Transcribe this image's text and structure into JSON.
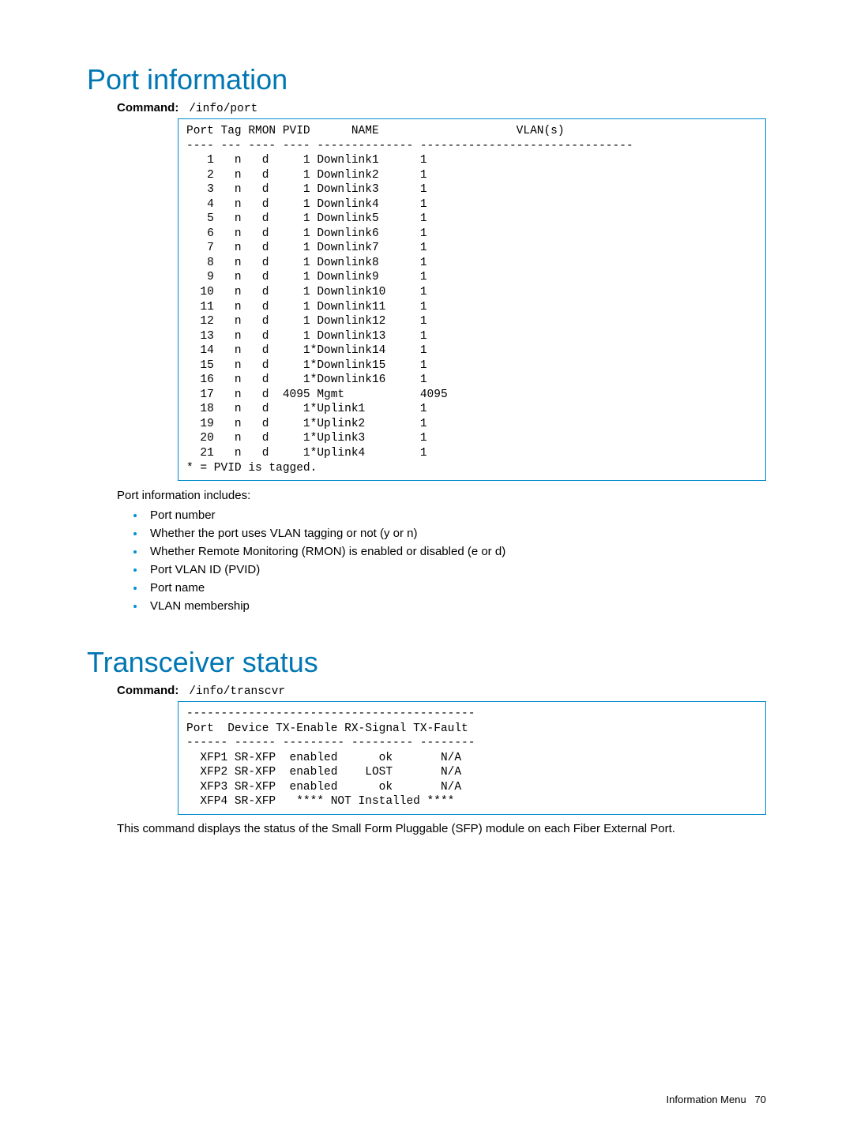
{
  "section1": {
    "title": "Port information",
    "cmd_label": "Command:",
    "cmd_value": "/info/port",
    "code": "Port Tag RMON PVID      NAME                    VLAN(s)\n---- --- ---- ---- -------------- -------------------------------\n   1   n   d     1 Downlink1      1\n   2   n   d     1 Downlink2      1\n   3   n   d     1 Downlink3      1\n   4   n   d     1 Downlink4      1\n   5   n   d     1 Downlink5      1\n   6   n   d     1 Downlink6      1\n   7   n   d     1 Downlink7      1\n   8   n   d     1 Downlink8      1\n   9   n   d     1 Downlink9      1\n  10   n   d     1 Downlink10     1\n  11   n   d     1 Downlink11     1\n  12   n   d     1 Downlink12     1\n  13   n   d     1 Downlink13     1\n  14   n   d     1*Downlink14     1\n  15   n   d     1*Downlink15     1\n  16   n   d     1*Downlink16     1\n  17   n   d  4095 Mgmt           4095\n  18   n   d     1*Uplink1        1\n  19   n   d     1*Uplink2        1\n  20   n   d     1*Uplink3        1\n  21   n   d     1*Uplink4        1\n* = PVID is tagged.",
    "intro": "Port information includes:",
    "bullets": [
      "Port number",
      "Whether the port uses VLAN tagging or not (y or n)",
      "Whether Remote Monitoring (RMON) is enabled or disabled (e or d)",
      "Port VLAN ID (PVID)",
      "Port name",
      "VLAN membership"
    ]
  },
  "section2": {
    "title": "Transceiver status",
    "cmd_label": "Command:",
    "cmd_value": "/info/transcvr",
    "code": "------------------------------------------\nPort  Device TX-Enable RX-Signal TX-Fault\n------ ------ --------- --------- --------\n  XFP1 SR-XFP  enabled      ok       N/A\n  XFP2 SR-XFP  enabled    LOST       N/A\n  XFP3 SR-XFP  enabled      ok       N/A\n  XFP4 SR-XFP   **** NOT Installed ****",
    "body": "This command displays the status of the Small Form Pluggable (SFP) module on each Fiber External Port."
  },
  "footer": {
    "left": "Information Menu",
    "right": "70"
  }
}
